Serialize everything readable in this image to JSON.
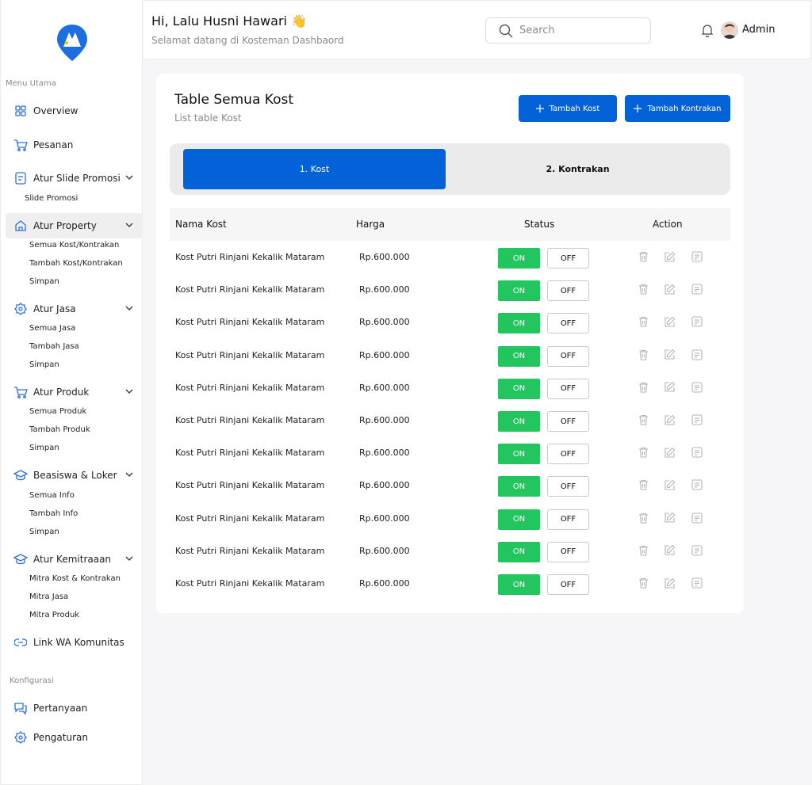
{
  "sidebar": {
    "menu_label": "Menu Utama",
    "config_label": "Konfigurasi",
    "overview": "Overview",
    "pesanan": "Pesanan",
    "slide": {
      "label": "Atur Slide Promosi",
      "sub": [
        "Slide Promosi"
      ]
    },
    "property": {
      "label": "Atur Property",
      "sub": [
        "Semua Kost/Kontrakan",
        "Tambah Kost/Kontrakan",
        "Simpan"
      ]
    },
    "jasa": {
      "label": "Atur Jasa",
      "sub": [
        "Semua Jasa",
        "Tambah Jasa",
        "Simpan"
      ]
    },
    "produk": {
      "label": "Atur Produk",
      "sub": [
        "Semua Produk",
        "Tambah Produk",
        "Simpan"
      ]
    },
    "beasiswa": {
      "label": "Beasiswa & Loker",
      "sub": [
        "Semua Info",
        "Tambah Info",
        "Simpan"
      ]
    },
    "kemitraan": {
      "label": "Atur Kemitraaan",
      "sub": [
        "Mitra Kost & Kontrakan",
        "Mitra Jasa",
        "Mitra Produk"
      ]
    },
    "link_wa": "Link WA Komunitas",
    "pertanyaan": "Pertanyaan",
    "pengaturan": "Pengaturan"
  },
  "header": {
    "greeting": "Hi, Lalu Husni Hawari 👋",
    "subtitle": "Selamat datang di Kosteman Dashbaord",
    "search_placeholder": "Search",
    "user": "Admin"
  },
  "main": {
    "title": "Table Semua Kost",
    "subtitle": "List table Kost",
    "btn_tambah_kost": "Tambah Kost",
    "btn_tambah_kontrakan": "Tambah Kontrakan",
    "tabs": [
      "1. Kost",
      "2. Kontrakan"
    ],
    "columns": [
      "Nama Kost",
      "Harga",
      "Status",
      "Action"
    ],
    "on_label": "ON",
    "off_label": "OFF",
    "rows": [
      {
        "name": "Kost Putri Rinjani Kekalik Mataram",
        "price": "Rp.600.000"
      },
      {
        "name": "Kost Putri Rinjani Kekalik Mataram",
        "price": "Rp.600.000"
      },
      {
        "name": "Kost Putri Rinjani Kekalik Mataram",
        "price": "Rp.600.000"
      },
      {
        "name": "Kost Putri Rinjani Kekalik Mataram",
        "price": "Rp.600.000"
      },
      {
        "name": "Kost Putri Rinjani Kekalik Mataram",
        "price": "Rp.600.000"
      },
      {
        "name": "Kost Putri Rinjani Kekalik Mataram",
        "price": "Rp.600.000"
      },
      {
        "name": "Kost Putri Rinjani Kekalik Mataram",
        "price": "Rp.600.000"
      },
      {
        "name": "Kost Putri Rinjani Kekalik Mataram",
        "price": "Rp.600.000"
      },
      {
        "name": "Kost Putri Rinjani Kekalik Mataram",
        "price": "Rp.600.000"
      },
      {
        "name": "Kost Putri Rinjani Kekalik Mataram",
        "price": "Rp.600.000"
      },
      {
        "name": "Kost Putri Rinjani Kekalik Mataram",
        "price": "Rp.600.000"
      }
    ]
  },
  "colors": {
    "primary": "#0462d8",
    "on_green": "#22c55e",
    "icon_blue": "#2f6fd6"
  }
}
